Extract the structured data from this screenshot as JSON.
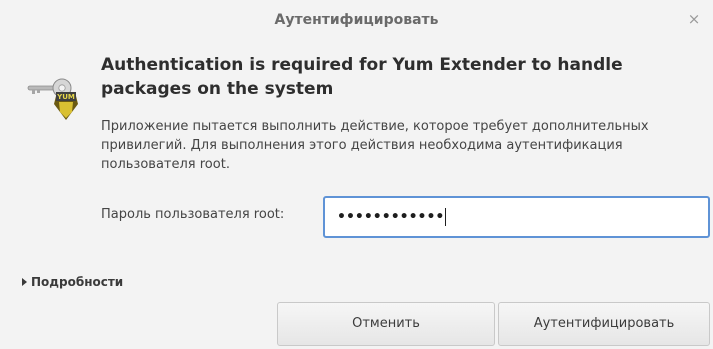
{
  "window": {
    "title": "Аутентифицировать",
    "close_glyph": "×"
  },
  "icon": {
    "name": "keys-authentication-icon",
    "badge_text": "YUM"
  },
  "message": {
    "heading": "Authentication is required for Yum Extender to handle packages on the system",
    "description": "Приложение пытается выполнить действие, которое требует дополнительных привилегий. Для выполнения этого действия необходима аутентификация пользователя root."
  },
  "password": {
    "label": "Пароль пользователя root:",
    "masked_value": "••••••••••••"
  },
  "details": {
    "label": "Подробности"
  },
  "buttons": {
    "cancel_label": "Отменить",
    "authenticate_label": "Аутентифицировать"
  },
  "colors": {
    "background": "#f3f3f3",
    "focus_border": "#5f93d6"
  }
}
